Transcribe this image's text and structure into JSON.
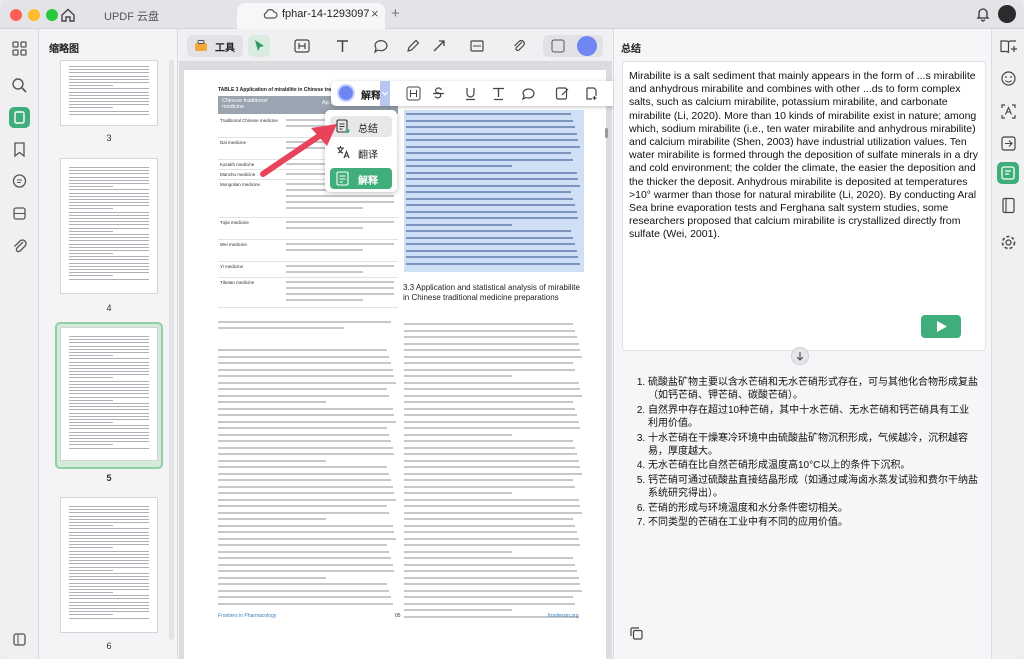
{
  "titlebar": {
    "cloud_tab": "UPDF 云盘",
    "doc_tab": "fphar-14-1293097",
    "close_tab": "×",
    "new_tab": "+"
  },
  "thumbnails": {
    "title": "缩略图",
    "pages": [
      "3",
      "4",
      "5",
      "6"
    ],
    "selected": "5"
  },
  "toolbar": {
    "tools_label": "工具"
  },
  "floating": {
    "explain_label": "解释",
    "menu": [
      "总结",
      "翻译",
      "解释"
    ]
  },
  "document": {
    "table_title": "TABLE 3 Application of mirabilite in Chinese tra...",
    "table_header": [
      "Chinese traditional medicine",
      "Ap..."
    ],
    "table_rows": [
      "Traditional Chinese medicine",
      "Dai medicine",
      "Kazakh medicine",
      "Manchu medicine",
      "Mongolian medicine",
      "Tujia medicine",
      "Wei medicine",
      "Yi medicine",
      "Tibetan medicine"
    ],
    "section_heading": "3.3 Application and statistical analysis of mirabilite in Chinese traditional medicine preparations",
    "footer_left": "Frontiers in Pharmacology",
    "footer_center": "05",
    "footer_right": "frontiersin.org"
  },
  "right_panel": {
    "title": "总结",
    "summary": "Mirabilite is a salt sediment that mainly appears in the form of ...s mirabilite and anhydrous mirabilite and combines with other ...ds to form complex salts, such as calcium mirabilite, potassium mirabilite, and carbonate mirabilite (Li, 2020). More than 10 kinds of mirabilite exist in nature; among which, sodium mirabilite (i.e., ten water mirabilite and anhydrous mirabilite) and calcium mirabilite (Shen, 2003) have industrial utilization values. Ten water mirabilite is formed through the deposition of sulfate minerals in a dry and cold environment; the colder the climate, the easier the deposition and the thicker the deposit. Anhydrous mirabilite is deposited at temperatures >10° warmer than those for natural mirabilite (Li, 2020). By conducting Aral Sea brine evaporation tests and Ferghana salt system studies, some researchers proposed that calcium mirabilite is crystallized directly from sulfate (Wei, 2001).",
    "results": [
      "硫酸盐矿物主要以含水芒硝和无水芒硝形式存在，可与其他化合物形成复盐（如钙芒硝、钾芒硝、碳酸芒硝）。",
      "自然界中存在超过10种芒硝，其中十水芒硝、无水芒硝和钙芒硝具有工业利用价值。",
      "十水芒硝在干燥寒冷环境中由硫酸盐矿物沉积形成，气候越冷，沉积越容易，厚度越大。",
      "无水芒硝在比自然芒硝形成温度高10°C以上的条件下沉积。",
      "钙芒硝可通过硫酸盐直接结晶形成（如通过咸海卤水蒸发试验和费尔干纳盐系统研究得出）。",
      "芒硝的形成与环境温度和水分条件密切相关。",
      "不同类型的芒硝在工业中有不同的应用价值。"
    ]
  },
  "colors": {
    "accent": "#3fae7a",
    "selection": "#cfe0f6",
    "arrow": "#e8435a"
  }
}
